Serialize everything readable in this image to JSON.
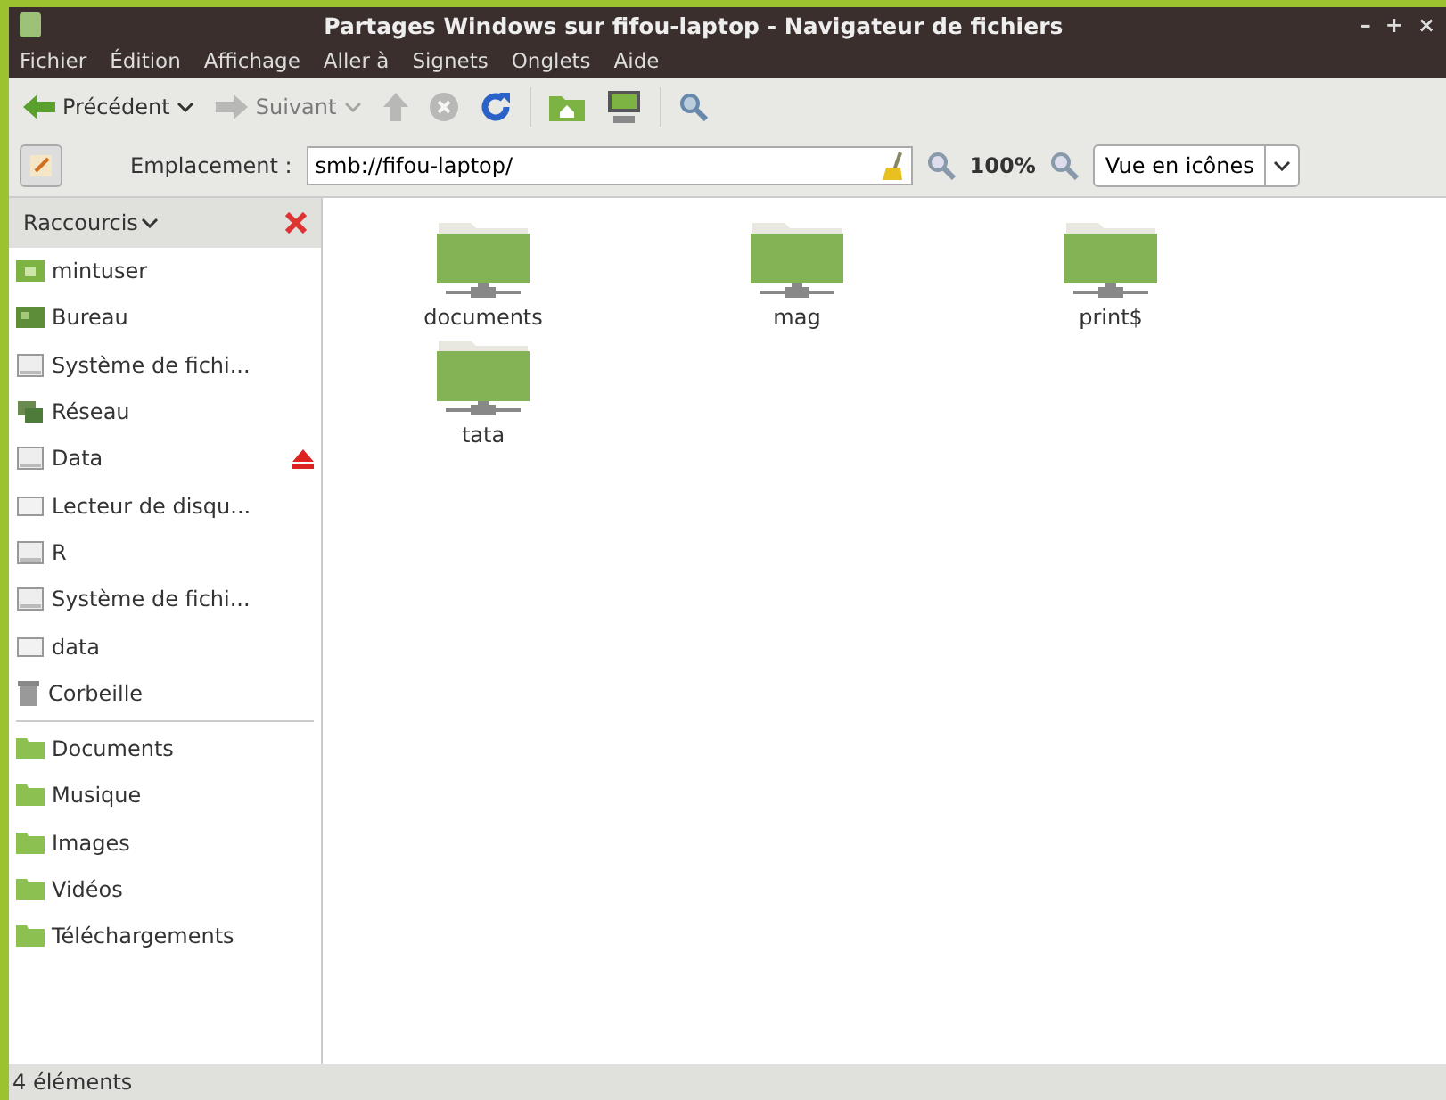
{
  "window": {
    "title": "Partages Windows sur fifou-laptop - Navigateur de fichiers",
    "controls": [
      "–",
      "+",
      "×"
    ]
  },
  "menu": [
    "Fichier",
    "Édition",
    "Affichage",
    "Aller à",
    "Signets",
    "Onglets",
    "Aide"
  ],
  "toolbar": [
    {
      "kind": "back",
      "label": "Précédent",
      "disabled": false,
      "dropdown": true
    },
    {
      "kind": "forward",
      "label": "Suivant",
      "disabled": true,
      "dropdown": true
    },
    {
      "kind": "up",
      "disabled": true
    },
    {
      "kind": "stop",
      "disabled": true
    },
    {
      "kind": "reload",
      "disabled": false
    },
    {
      "kind": "sep"
    },
    {
      "kind": "home",
      "disabled": false
    },
    {
      "kind": "computer",
      "disabled": false
    },
    {
      "kind": "sep"
    },
    {
      "kind": "search",
      "disabled": false
    }
  ],
  "location": {
    "label": "Emplacement :",
    "value": "smb://fifou-laptop/",
    "zoom": "100%",
    "view": "Vue en icônes"
  },
  "sidebar": {
    "title": "Raccourcis",
    "places": [
      {
        "label": "mintuser",
        "kind": "home",
        "ejectable": false
      },
      {
        "label": "Bureau",
        "kind": "desktop",
        "ejectable": false
      },
      {
        "label": "Système de fichi...",
        "kind": "drive",
        "ejectable": false
      },
      {
        "label": "Réseau",
        "kind": "network",
        "ejectable": false
      },
      {
        "label": "Data",
        "kind": "drive",
        "ejectable": true
      },
      {
        "label": "Lecteur de disqu...",
        "kind": "disk",
        "ejectable": false
      },
      {
        "label": "R",
        "kind": "drive",
        "ejectable": false
      },
      {
        "label": "Système de fichi...",
        "kind": "drive",
        "ejectable": false
      },
      {
        "label": "data",
        "kind": "disk",
        "ejectable": false
      },
      {
        "label": "Corbeille",
        "kind": "trash",
        "ejectable": false
      }
    ],
    "bookmarks": [
      {
        "label": "Documents",
        "kind": "folder",
        "ejectable": false
      },
      {
        "label": "Musique",
        "kind": "folder",
        "ejectable": false
      },
      {
        "label": "Images",
        "kind": "folder",
        "ejectable": false
      },
      {
        "label": "Vidéos",
        "kind": "folder",
        "ejectable": false
      },
      {
        "label": "Téléchargements",
        "kind": "folder",
        "ejectable": false
      }
    ]
  },
  "files": [
    {
      "name": "documents"
    },
    {
      "name": "mag"
    },
    {
      "name": "print$"
    },
    {
      "name": "tata"
    }
  ],
  "status_bar": "4 éléments"
}
